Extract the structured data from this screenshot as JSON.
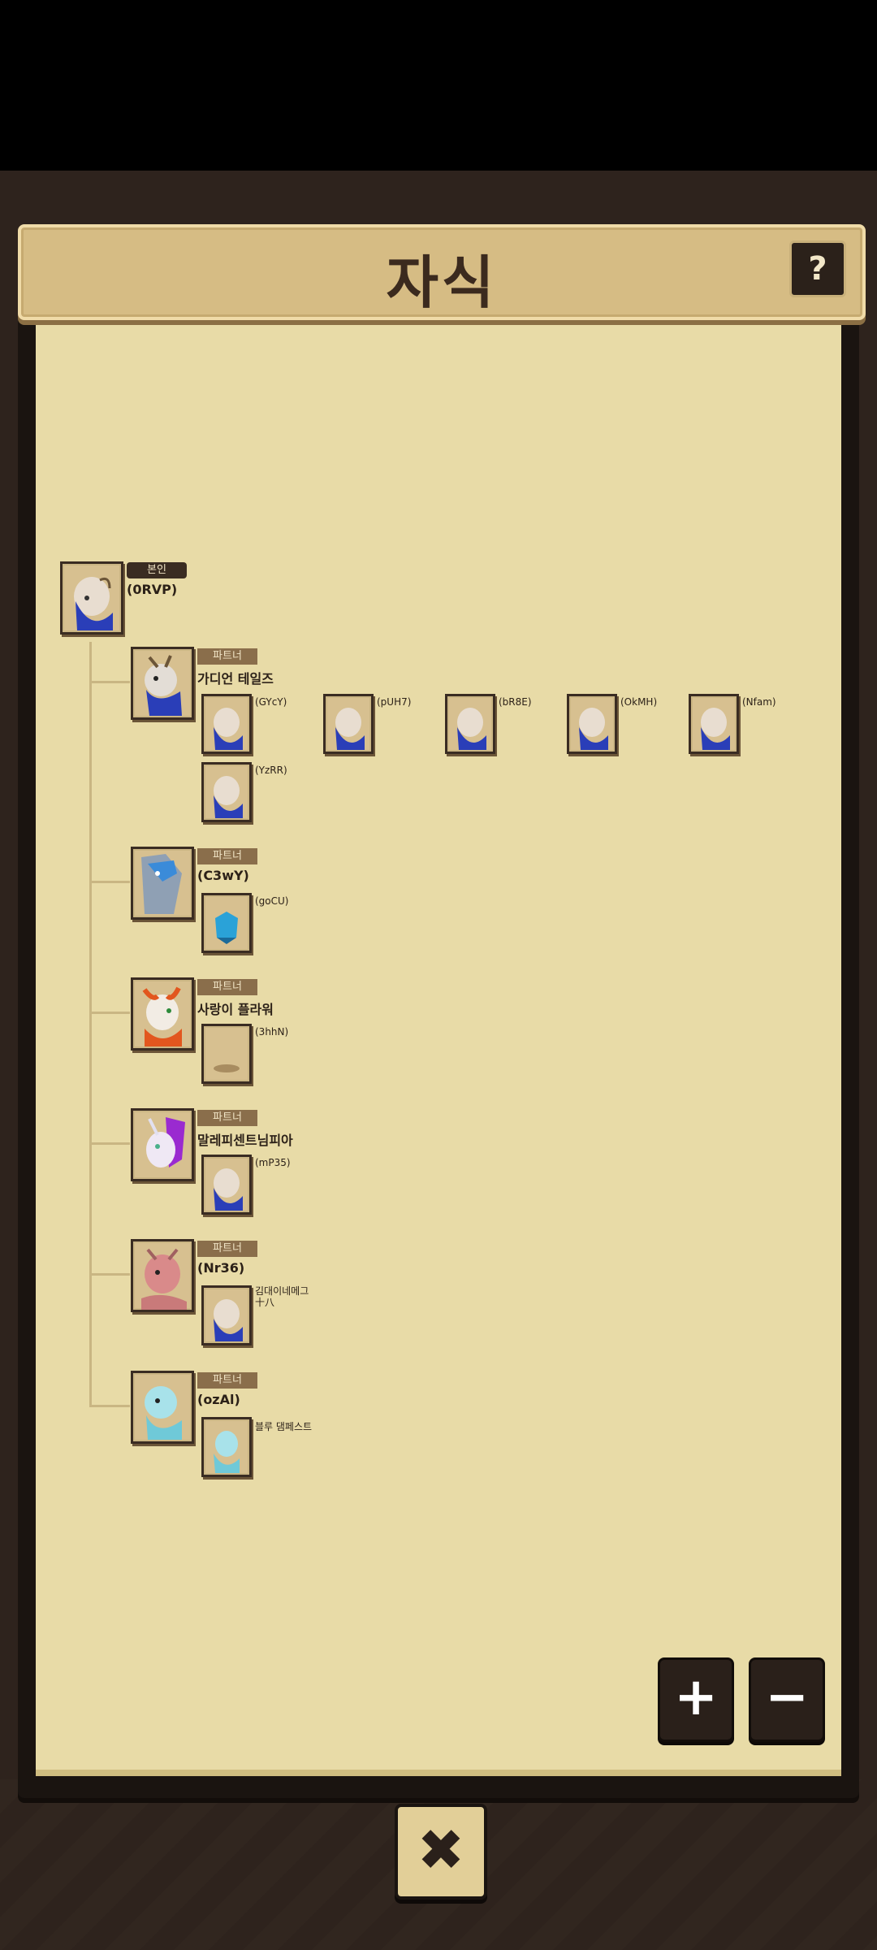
{
  "title": "자식",
  "help_label": "?",
  "close_label": "✖",
  "zoom": {
    "in_label": "+",
    "out_label": "−"
  },
  "self": {
    "badge": "본인",
    "name": "(0RVP)"
  },
  "partner_badge": "파트너",
  "partners": [
    {
      "name": "가디언 테일즈",
      "children": [
        "(GYcY)",
        "(pUH7)",
        "(bR8E)",
        "(OkMH)",
        "(Nfam)",
        "(YzRR)"
      ]
    },
    {
      "name": "(C3wY)",
      "children": [
        "(goCU)"
      ]
    },
    {
      "name": "사랑이 플라워",
      "children": [
        "(3hhN)"
      ]
    },
    {
      "name": "말레피센트님피아",
      "children": [
        "(mP35)"
      ]
    },
    {
      "name": "(Nr36)",
      "children": [
        "김대이네메그\n十八"
      ]
    },
    {
      "name": "(ozAl)",
      "children": [
        "블루 댐페스트"
      ]
    }
  ]
}
